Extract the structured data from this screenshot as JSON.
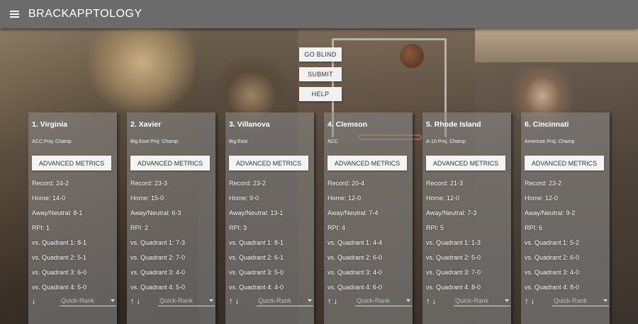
{
  "app": {
    "title": "BRACKAPPTOLOGY",
    "menu_icon": "hamburger-menu-icon"
  },
  "actions": {
    "go_blind": "GO BLIND",
    "submit": "SUBMIT",
    "help": "HELP"
  },
  "labels": {
    "advanced_metrics": "ADVANCED METRICS",
    "quick_rank": "Quick-Rank",
    "up_arrow": "↑",
    "down_arrow": "↓"
  },
  "teams": [
    {
      "name": "1. Virginia",
      "conference": "ACC Proj. Champ",
      "record": "Record: 24-2",
      "home": "Home: 14-0",
      "away": "Away/Neutral: 8-1",
      "rpi": "RPI: 1",
      "q1": "vs. Quadrant 1: 8-1",
      "q2": "vs. Quadrant 2: 5-1",
      "q3": "vs. Quadrant 3: 6-0",
      "q4": "vs. Quadrant 4: 5-0",
      "show_up": false
    },
    {
      "name": "2. Xavier",
      "conference": "Big East Proj. Champ",
      "record": "Record: 23-3",
      "home": "Home: 15-0",
      "away": "Away/Neutral: 6-3",
      "rpi": "RPI: 2",
      "q1": "vs. Quadrant 1: 7-3",
      "q2": "vs. Quadrant 2: 7-0",
      "q3": "vs. Quadrant 3: 4-0",
      "q4": "vs. Quadrant 4: 5-0",
      "show_up": true
    },
    {
      "name": "3. Villanova",
      "conference": "Big East",
      "record": "Record: 23-2",
      "home": "Home: 9-0",
      "away": "Away/Neutral: 13-1",
      "rpi": "RPI: 3",
      "q1": "vs. Quadrant 1: 8-1",
      "q2": "vs. Quadrant 2: 6-1",
      "q3": "vs. Quadrant 3: 5-0",
      "q4": "vs. Quadrant 4: 4-0",
      "show_up": true
    },
    {
      "name": "4. Clemson",
      "conference": "ACC",
      "record": "Record: 20-4",
      "home": "Home: 12-0",
      "away": "Away/Neutral: 7-4",
      "rpi": "RPI: 4",
      "q1": "vs. Quadrant 1: 4-4",
      "q2": "vs. Quadrant 2: 6-0",
      "q3": "vs. Quadrant 3: 4-0",
      "q4": "vs. Quadrant 4: 6-0",
      "show_up": true
    },
    {
      "name": "5. Rhode Island",
      "conference": "A-10 Proj. Champ",
      "record": "Record: 21-3",
      "home": "Home: 12-0",
      "away": "Away/Neutral: 7-3",
      "rpi": "RPI: 5",
      "q1": "vs. Quadrant 1: 1-3",
      "q2": "vs. Quadrant 2: 5-0",
      "q3": "vs. Quadrant 3: 7-0",
      "q4": "vs. Quadrant 4: 8-0",
      "show_up": true
    },
    {
      "name": "6. Cincinnati",
      "conference": "American Proj. Champ",
      "record": "Record: 23-2",
      "home": "Home: 12-0",
      "away": "Away/Neutral: 9-2",
      "rpi": "RPI: 6",
      "q1": "vs. Quadrant 1: 5-2",
      "q2": "vs. Quadrant 2: 6-0",
      "q3": "vs. Quadrant 3: 4-0",
      "q4": "vs. Quadrant 4: 8-0",
      "show_up": true
    }
  ]
}
